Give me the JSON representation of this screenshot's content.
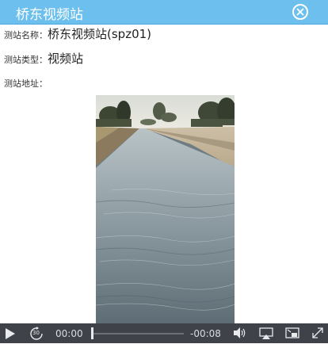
{
  "window": {
    "title": "桥东视频站",
    "close_icon": "close-circle-icon"
  },
  "station": {
    "name_label": "测站名称：",
    "name_value": "桥东视频站(spz01)",
    "type_label": "测站类型：",
    "type_value": "视频站",
    "address_label": "测站地址：",
    "address_value": ""
  },
  "player": {
    "current_time": "00:00",
    "remaining_time": "-00:08",
    "progress": 0,
    "icons": [
      "play-icon",
      "rewind-30-icon",
      "volume-icon",
      "airplay-icon",
      "picture-in-picture-icon",
      "fullscreen-icon"
    ],
    "skip_back_seconds": "30"
  },
  "colors": {
    "titlebar": "#6dc0ee",
    "controls_bg": "#3f4349",
    "water": "#8a98a0"
  }
}
